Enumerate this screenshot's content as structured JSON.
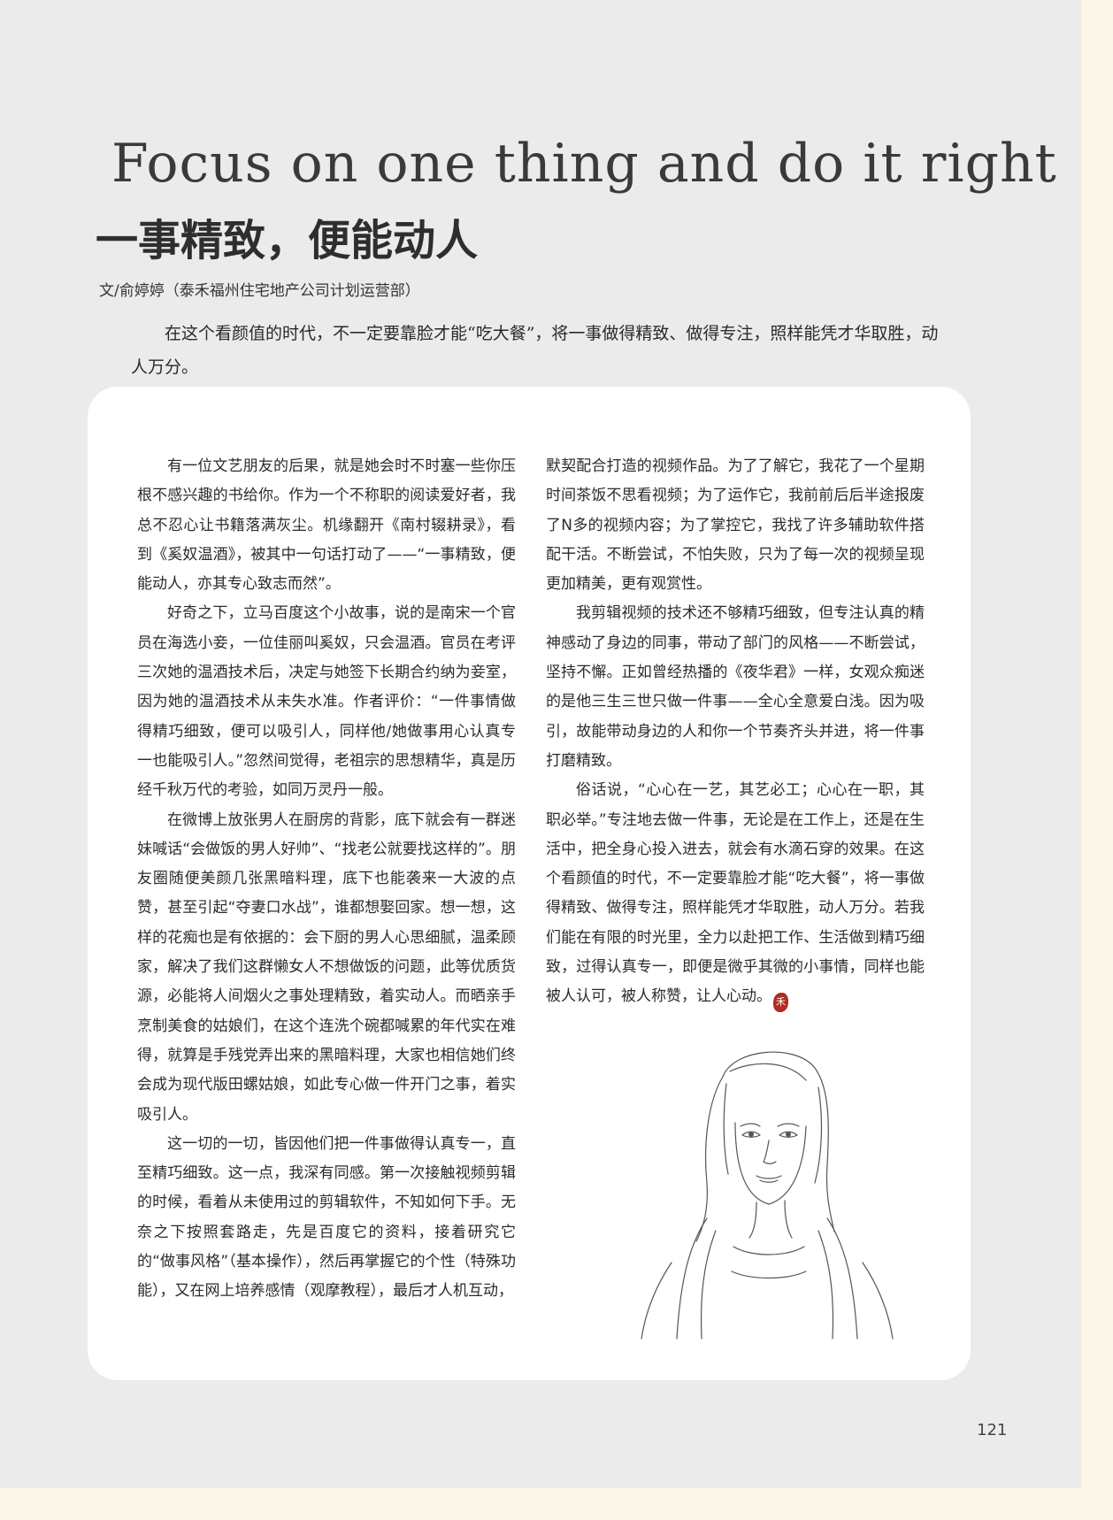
{
  "article": {
    "title_en": "Focus on one thing and do it right",
    "title_cn": "一事精致，便能动人",
    "author": "文/俞婷婷（泰禾福州住宅地产公司计划运营部）",
    "lead": "在这个看颜值的时代，不一定要靠脸才能“吃大餐”，将一事做得精致、做得专注，照样能凭才华取胜，动人万分。",
    "left_paragraphs": [
      "有一位文艺朋友的后果，就是她会时不时塞一些你压根不感兴趣的书给你。作为一个不称职的阅读爱好者，我总不忍心让书籍落满灰尘。机缘翻开《南村辍耕录》，看到《奚奴温酒》，被其中一句话打动了——“一事精致，便能动人，亦其专心致志而然”。",
      "好奇之下，立马百度这个小故事，说的是南宋一个官员在海选小妾，一位佳丽叫奚奴，只会温酒。官员在考评三次她的温酒技术后，决定与她签下长期合约纳为妾室，因为她的温酒技术从未失水准。作者评价：“一件事情做得精巧细致，便可以吸引人，同样他/她做事用心认真专一也能吸引人。”忽然间觉得，老祖宗的思想精华，真是历经千秋万代的考验，如同万灵丹一般。",
      "在微博上放张男人在厨房的背影，底下就会有一群迷妹喊话“会做饭的男人好帅”、“找老公就要找这样的”。朋友圈随便美颜几张黑暗料理，底下也能袭来一大波的点赞，甚至引起“夺妻口水战”，谁都想娶回家。想一想，这样的花痴也是有依据的：会下厨的男人心思细腻，温柔顾家，解决了我们这群懒女人不想做饭的问题，此等优质货源，必能将人间烟火之事处理精致，着实动人。而晒亲手烹制美食的姑娘们，在这个连洗个碗都喊累的年代实在难得，就算是手残党弄出来的黑暗料理，大家也相信她们终会成为现代版田螺姑娘，如此专心做一件开门之事，着实吸引人。",
      "这一切的一切，皆因他们把一件事做得认真专一，直至精巧细致。这一点，我深有同感。第一次接触视频剪辑的时候，看着从未使用过的剪辑软件，不知如何下手。无奈之下按照套路走，先是百度它的资料，接着研究它的“做事风格”（基本操作），然后再掌握它的个性（特殊功能），又在网上培养感情（观摩教程），最后才人机互动，"
    ],
    "right_continuation": "默契配合打造的视频作品。为了了解它，我花了一个星期时间茶饭不思看视频；为了运作它，我前前后后半途报废了N多的视频内容；为了掌控它，我找了许多辅助软件搭配干活。不断尝试，不怕失败，只为了每一次的视频呈现更加精美，更有观赏性。",
    "right_paragraphs": [
      "我剪辑视频的技术还不够精巧细致，但专注认真的精神感动了身边的同事，带动了部门的风格——不断尝试，坚持不懈。正如曾经热播的《夜华君》一样，女观众痴迷的是他三生三世只做一件事——全心全意爱白浅。因为吸引，故能带动身边的人和你一个节奏齐头并进，将一件事打磨精致。",
      "俗话说，“心心在一艺，其艺必工；心心在一职，其职必举。”专注地去做一件事，无论是在工作上，还是在生活中，把全身心投入进去，就会有水滴石穿的效果。在这个看颜值的时代，不一定要靠脸才能“吃大餐”，将一事做得精致、做得专注，照样能凭才华取胜，动人万分。若我们能在有限的时光里，全力以赴把工作、生活做到精巧细致，过得认真专一，即便是微乎其微的小事情，同样也能被人认可，被人称赞，让人心动。"
    ],
    "end_mark_icon": "red-seal-end-mark-icon"
  },
  "illustration": {
    "icon": "pencil-sketch-portrait-icon"
  },
  "page_number": "121",
  "colors": {
    "page_background": "#ebebeb",
    "margin_background": "#fbf6e8",
    "card_background": "#ffffff",
    "seal_red": "#b32a22"
  }
}
